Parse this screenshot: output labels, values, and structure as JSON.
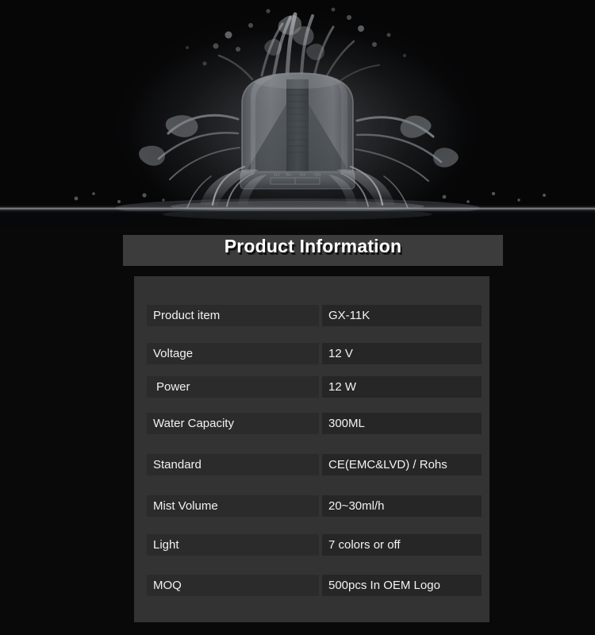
{
  "hero": {
    "alt": "aroma-diffuser-splashing-into-water",
    "product_base_markings": "1H  3H  6H  ON"
  },
  "section": {
    "title": "Product Information"
  },
  "spec_table": {
    "rows": [
      {
        "label": "Product item",
        "value": "GX-11K"
      },
      {
        "label": "Voltage",
        "value": "12 V"
      },
      {
        "label": "Power",
        "value": "12 W"
      },
      {
        "label": "Water Capacity",
        "value": "300ML"
      },
      {
        "label": "Standard",
        "value": "CE(EMC&LVD) / Rohs"
      },
      {
        "label": "Mist Volume",
        "value": "20~30ml/h"
      },
      {
        "label": "Light",
        "value": "7 colors or off"
      },
      {
        "label": "MOQ",
        "value": "500pcs  In OEM Logo"
      }
    ]
  },
  "colors": {
    "page_background": "#090909",
    "title_bar": "#3c3c3c",
    "card_background": "#333333",
    "label_cell": "#2b2b2b",
    "value_cell": "#262626",
    "text": "#f2f2f2"
  }
}
